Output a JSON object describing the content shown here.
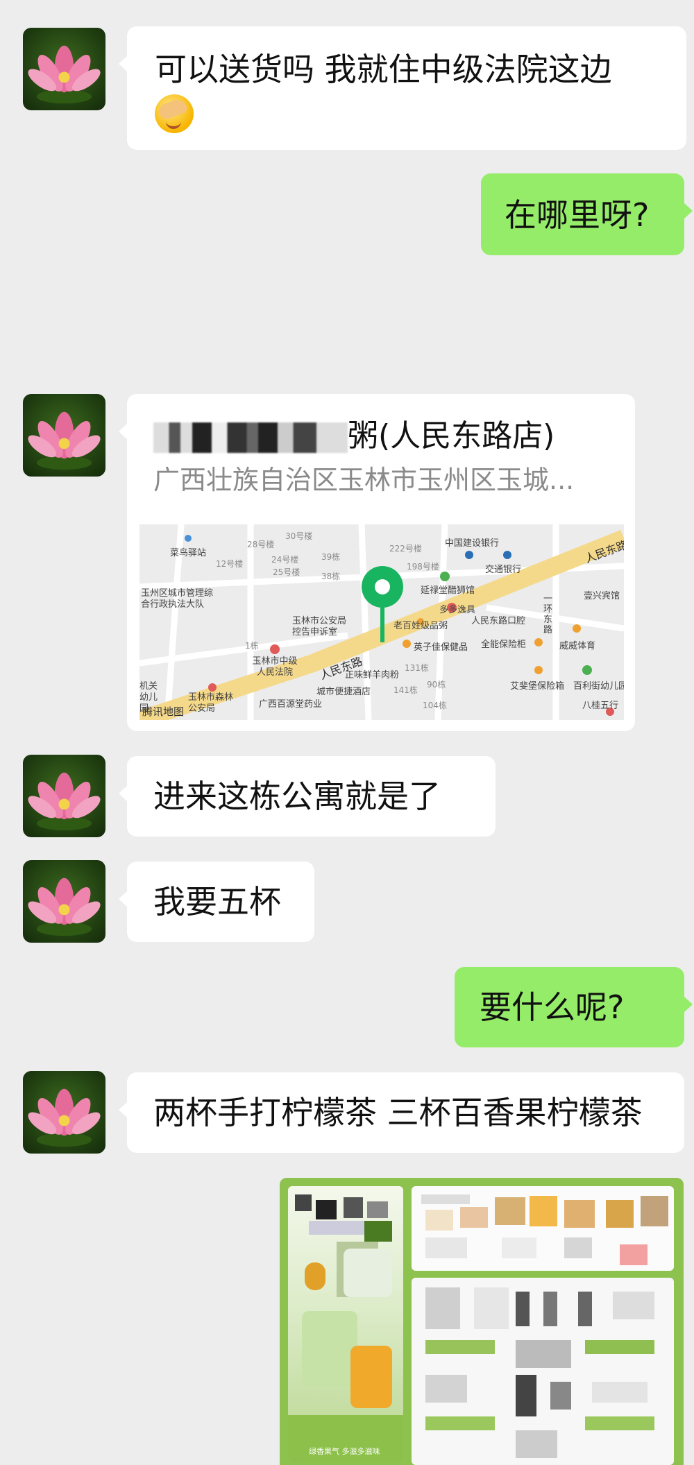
{
  "messages": [
    {
      "from": "them",
      "text": "可以送货吗 我就住中级法院这边",
      "emoji": "face-palm-emoji"
    },
    {
      "from": "me",
      "text": "在哪里呀?"
    },
    {
      "from": "them",
      "type": "location",
      "title_suffix": "粥(人民东路店)",
      "address": "广西壮族自治区玉林市玉州区玉城...",
      "map_credit": "腾讯地图"
    },
    {
      "from": "them",
      "text": "进来这栋公寓就是了"
    },
    {
      "from": "them",
      "text": "我要五杯"
    },
    {
      "from": "me",
      "text": "要什么呢?"
    },
    {
      "from": "them",
      "text": "两杯手打柠檬茶 三杯百香果柠檬茶"
    },
    {
      "from": "me",
      "type": "image",
      "caption": "绿香果气 多滋多滋味"
    }
  ],
  "map": {
    "labels": [
      "菜鸟驿站",
      "30号楼",
      "28号楼",
      "12号楼",
      "24号楼",
      "25号楼",
      "39栋",
      "38栋",
      "222号楼",
      "198号楼",
      "中国建设银行",
      "交通银行",
      "延禄堂醋狮馆",
      "玉州区城市管理综合行政执法大队",
      "玉林市公安局控告申诉室",
      "老百姓级品粥",
      "多多逸具",
      "人民东路口腔",
      "壹兴宾馆",
      "1栋",
      "玉林市中级人民法院",
      "英子佳保健品",
      "全能保险柜",
      "威威体育",
      "人民东路",
      "正味鲜羊肉粉",
      "131栋",
      "90栋",
      "艾斐堡保险箱",
      "百利街幼儿园",
      "机关幼儿园",
      "城市便捷酒店",
      "141栋",
      "玉林市森林公安局",
      "广西百源堂药业",
      "104栋",
      "八桂五行",
      "一环东路",
      "人民东路"
    ]
  },
  "colors": {
    "background": "#ededed",
    "incoming_bubble": "#ffffff",
    "outgoing_bubble": "#95ec69",
    "map_pin": "#19b45f",
    "main_road": "#f5d98a"
  }
}
